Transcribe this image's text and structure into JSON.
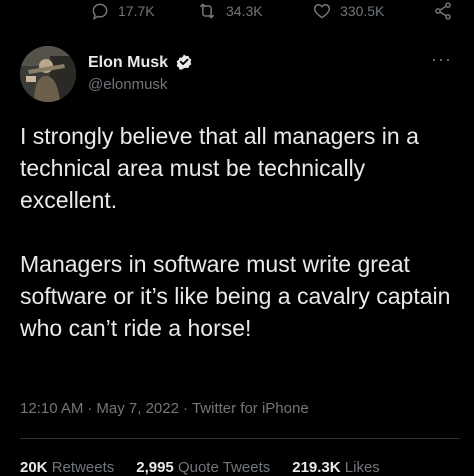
{
  "actions": {
    "reply_count": "17.7K",
    "retweet_count": "34.3K",
    "like_count": "330.5K"
  },
  "author": {
    "display_name": "Elon Musk",
    "handle": "@elonmusk",
    "verified": true
  },
  "tweet": {
    "paragraphs": [
      "I strongly believe that all managers in a technical area must be technically excellent.",
      "Managers in software must write great software or it’s like being a cavalry captain who can’t ride a horse!"
    ]
  },
  "meta": {
    "time": "12:10 AM",
    "date": "May 7, 2022",
    "source": "Twitter for iPhone",
    "separator": "·"
  },
  "stats": [
    {
      "count": "20K",
      "label": "Retweets"
    },
    {
      "count": "2,995",
      "label": "Quote Tweets"
    },
    {
      "count": "219.3K",
      "label": "Likes"
    }
  ],
  "colors": {
    "background": "#000000",
    "text": "#e7e9ea",
    "muted": "#71767b",
    "divider": "#2f3336"
  }
}
